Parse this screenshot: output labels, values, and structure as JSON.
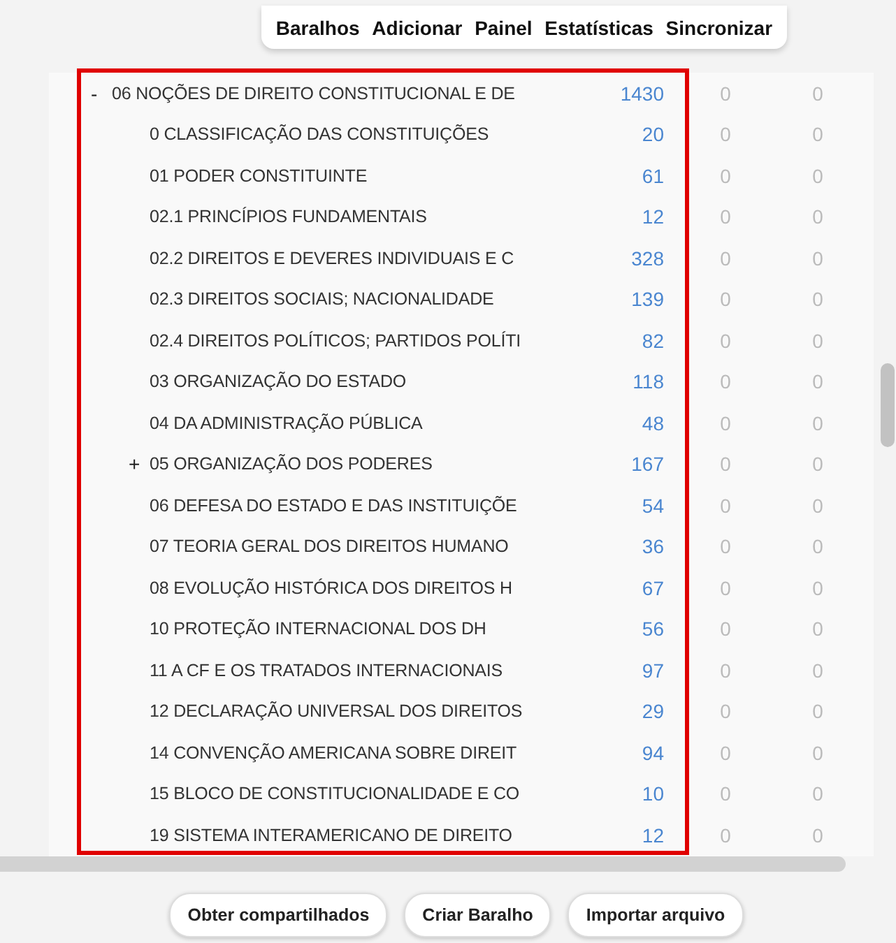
{
  "nav": [
    "Baralhos",
    "Adicionar",
    "Painel",
    "Estatísticas",
    "Sincronizar"
  ],
  "decks": [
    {
      "toggle": "-",
      "name": "06 NOÇÕES DE DIREITO CONSTITUCIONAL E DE",
      "counts": [
        "1430",
        "0",
        "0"
      ],
      "children": [
        {
          "name": "0 CLASSIFICAÇÃO DAS CONSTITUIÇÕES",
          "counts": [
            "20",
            "0",
            "0"
          ]
        },
        {
          "name": "01 PODER CONSTITUINTE",
          "counts": [
            "61",
            "0",
            "0"
          ]
        },
        {
          "name": "02.1 PRINCÍPIOS FUNDAMENTAIS",
          "counts": [
            "12",
            "0",
            "0"
          ]
        },
        {
          "name": "02.2 DIREITOS E DEVERES INDIVIDUAIS E C",
          "counts": [
            "328",
            "0",
            "0"
          ]
        },
        {
          "name": "02.3 DIREITOS SOCIAIS; NACIONALIDADE",
          "counts": [
            "139",
            "0",
            "0"
          ]
        },
        {
          "name": "02.4 DIREITOS POLÍTICOS; PARTIDOS POLÍTI",
          "counts": [
            "82",
            "0",
            "0"
          ]
        },
        {
          "name": "03 ORGANIZAÇÃO DO ESTADO",
          "counts": [
            "118",
            "0",
            "0"
          ]
        },
        {
          "name": "04 DA ADMINISTRAÇÃO PÚBLICA",
          "counts": [
            "48",
            "0",
            "0"
          ]
        },
        {
          "toggle": "+",
          "name": "05 ORGANIZAÇÃO DOS PODERES",
          "counts": [
            "167",
            "0",
            "0"
          ]
        },
        {
          "name": "06 DEFESA DO ESTADO E DAS INSTITUIÇÕE",
          "counts": [
            "54",
            "0",
            "0"
          ]
        },
        {
          "name": "07 TEORIA GERAL DOS DIREITOS HUMANO",
          "counts": [
            "36",
            "0",
            "0"
          ]
        },
        {
          "name": "08 EVOLUÇÃO HISTÓRICA DOS DIREITOS H",
          "counts": [
            "67",
            "0",
            "0"
          ]
        },
        {
          "name": "10 PROTEÇÃO INTERNACIONAL DOS DH",
          "counts": [
            "56",
            "0",
            "0"
          ]
        },
        {
          "name": "11 A CF E OS TRATADOS INTERNACIONAIS",
          "counts": [
            "97",
            "0",
            "0"
          ]
        },
        {
          "name": "12 DECLARAÇÃO UNIVERSAL DOS DIREITOS",
          "counts": [
            "29",
            "0",
            "0"
          ]
        },
        {
          "name": "14 CONVENÇÃO AMERICANA SOBRE DIREIT",
          "counts": [
            "94",
            "0",
            "0"
          ]
        },
        {
          "name": "15 BLOCO DE CONSTITUCIONALIDADE E CO",
          "counts": [
            "10",
            "0",
            "0"
          ]
        },
        {
          "name": "19 SISTEMA INTERAMERICANO DE DIREITO",
          "counts": [
            "12",
            "0",
            "0"
          ]
        }
      ]
    }
  ],
  "buttons": [
    "Obter compartilhados",
    "Criar Baralho",
    "Importar arquivo"
  ]
}
